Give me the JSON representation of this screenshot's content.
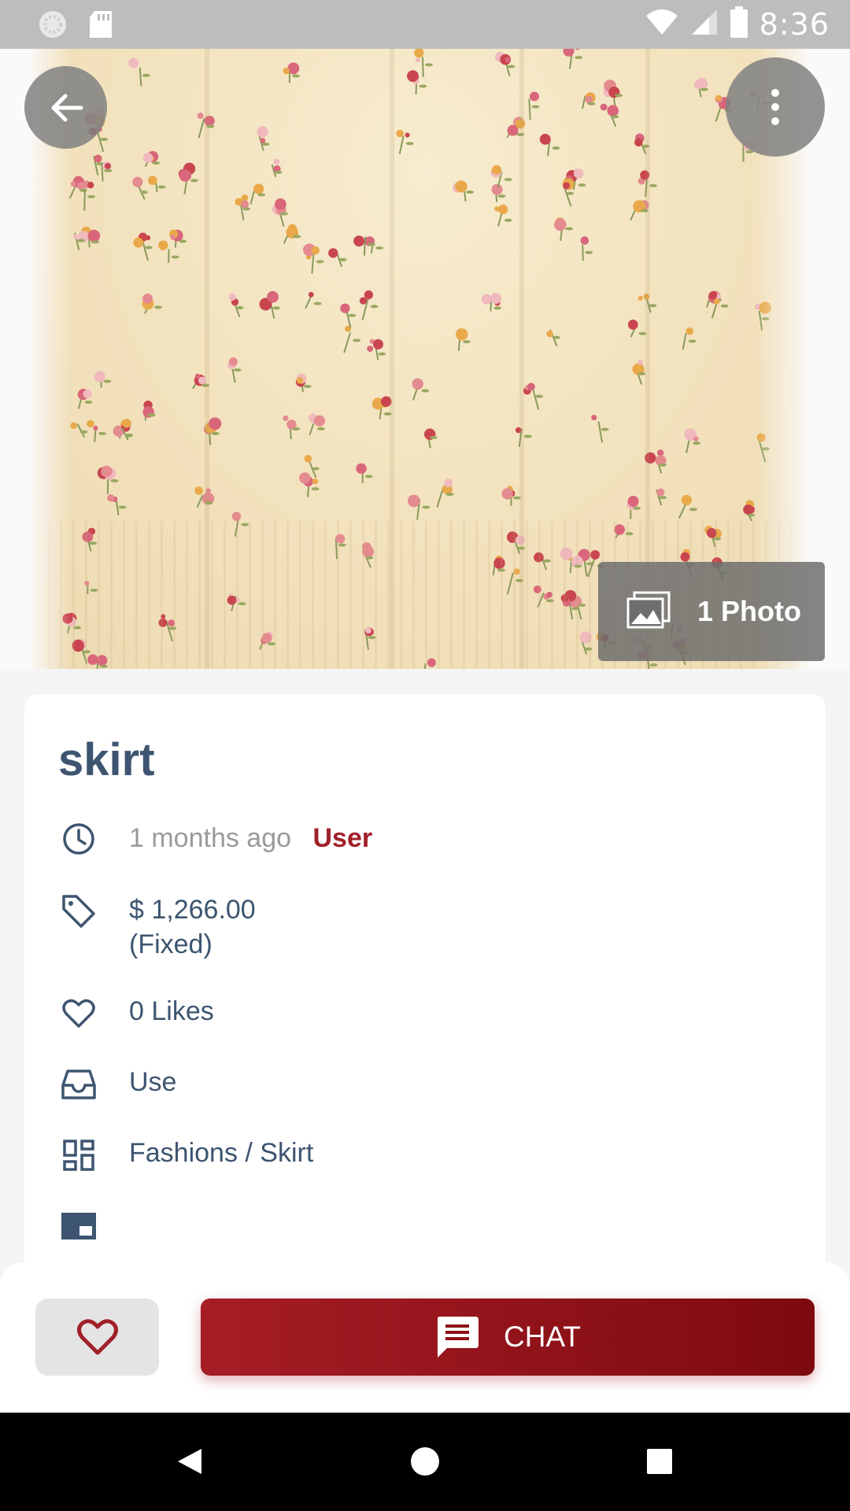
{
  "status_bar": {
    "time": "8:36",
    "icons": [
      "sync-icon",
      "sd-card-icon",
      "wifi-icon",
      "signal-icon",
      "battery-icon"
    ]
  },
  "hero": {
    "back_icon": "arrow-left-icon",
    "more_icon": "more-vertical-icon",
    "photo_count_label": "1 Photo",
    "photo_icon": "photos-icon"
  },
  "listing": {
    "title": "skirt",
    "posted_ago": "1 months ago",
    "seller": "User",
    "price": "$ 1,266.00",
    "price_type": "(Fixed)",
    "likes": "0 Likes",
    "condition": "Use",
    "category": "Fashions / Skirt"
  },
  "actions": {
    "chat_label": "CHAT"
  },
  "colors": {
    "accent": "#a1202a",
    "title": "#3d5570",
    "muted": "#9a9a9a",
    "status_bar": "#bdbdbd"
  }
}
